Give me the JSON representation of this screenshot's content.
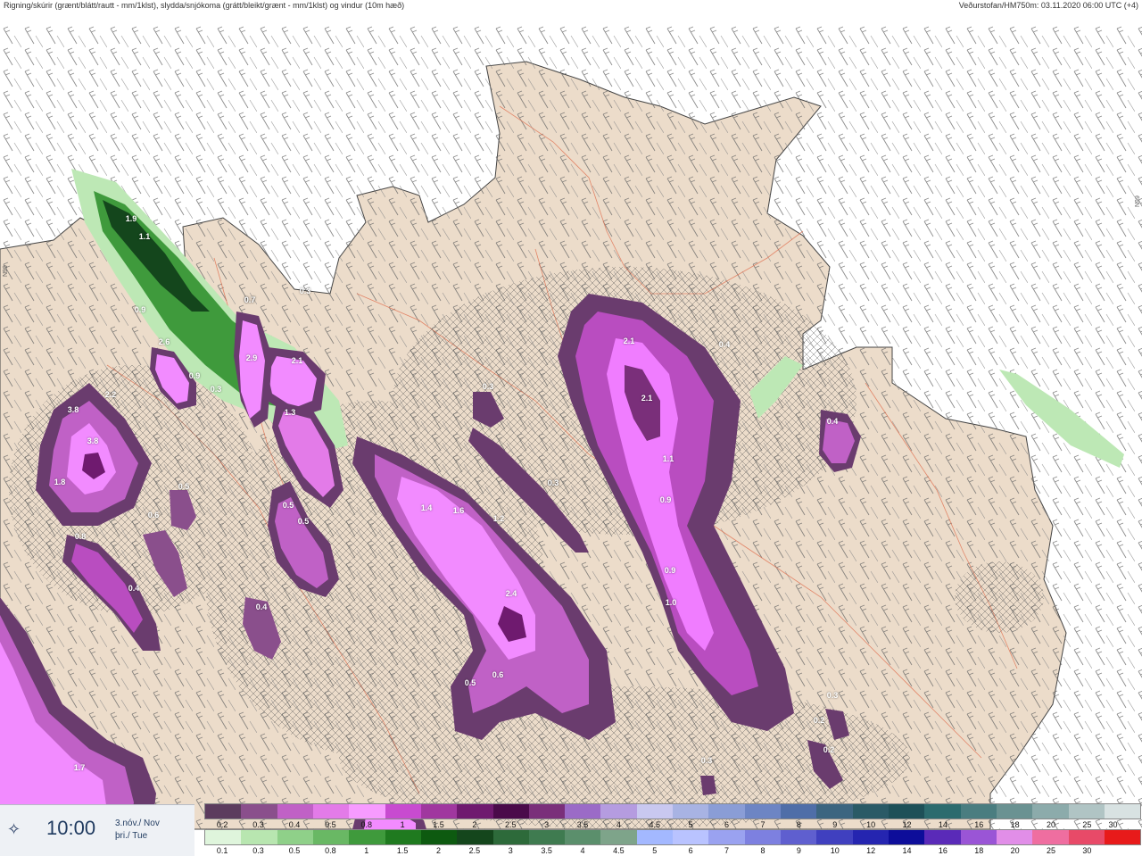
{
  "header": {
    "left_title": "Rigning/skúrir (grænt/blátt/rautt - mm/1klst), slydda/snjókoma (grátt/bleikt/grænt - mm/1klst) og vindur (10m hæð)",
    "right_title": "Veðurstofan/HM750m: 03.11.2020 06:00 UTC (+4)"
  },
  "grid_labels": {
    "left": "N99",
    "right": "N99"
  },
  "map_values": [
    "1.9",
    "1.1",
    "0.7",
    "0.9",
    "0.3",
    "2.6",
    "0.9",
    "0.3",
    "2.2",
    "3.8",
    "3.8",
    "1.8",
    "0.8",
    "0.5",
    "0.6",
    "0.4",
    "0.7",
    "2.9",
    "2.1",
    "0.3",
    "1.3",
    "0.5",
    "0.5",
    "0.4",
    "0.3",
    "1.4",
    "1.6",
    "1.2",
    "0.3",
    "2.4",
    "0.5",
    "0.6",
    "2.1",
    "0.4",
    "2.1",
    "1.1",
    "0.9",
    "0.9",
    "1.0",
    "0.4",
    "1.7",
    "0.3",
    "0.2",
    "0.2",
    "0.3"
  ],
  "timebox": {
    "logo_icon": "vedur-logo-icon",
    "time": "10:00",
    "date_line1": "3.nóv./ Nov",
    "date_line2": "þri./ Tue"
  },
  "legend_top": {
    "colors": [
      "#5c3c5e",
      "#8a4f8c",
      "#c061c6",
      "#e37be8",
      "#f79bff",
      "#c84bd0",
      "#a0379f",
      "#6f1a6f",
      "#4a0a4a",
      "#7a2f7a",
      "#9b6bc7",
      "#b59ce0",
      "#c9c8f0",
      "#a8b3e3",
      "#8a9dd6",
      "#6d85c4",
      "#4f6ea8",
      "#3c6580",
      "#2a5a66",
      "#1e5058",
      "#2c6b6e",
      "#4a7d80",
      "#6a9292",
      "#8cabab",
      "#b0c4c4",
      "#d8e2e2"
    ],
    "ticks": [
      "0.2",
      "0.3",
      "0.4",
      "0.5",
      "0.8",
      "1",
      "1.5",
      "2",
      "2.5",
      "3",
      "3.5",
      "4",
      "4.5",
      "5",
      "6",
      "7",
      "8",
      "9",
      "10",
      "12",
      "14",
      "16",
      "18",
      "20",
      "25",
      "30"
    ]
  },
  "legend_bottom": {
    "colors": [
      "#dff5dc",
      "#b8e6b0",
      "#8fd089",
      "#69b864",
      "#3f9a3c",
      "#1f7a1f",
      "#0d5a10",
      "#14461c",
      "#2d6a3a",
      "#3f7b50",
      "#5b8f6c",
      "#7ea48a",
      "#a3b8ff",
      "#b9c3ff",
      "#9aa2f0",
      "#7d80e0",
      "#5f5fcf",
      "#4040bf",
      "#2525b0",
      "#0d0d9a",
      "#5a2ab8",
      "#9a55d6",
      "#e18ee8",
      "#ef6ea0",
      "#e84a68",
      "#e81a1a"
    ],
    "ticks": [
      "0.1",
      "0.3",
      "0.5",
      "0.8",
      "1",
      "1.5",
      "2",
      "2.5",
      "3",
      "3.5",
      "4",
      "4.5",
      "5",
      "6",
      "7",
      "8",
      "9",
      "10",
      "12",
      "14",
      "16",
      "18",
      "20",
      "25",
      "30"
    ]
  }
}
